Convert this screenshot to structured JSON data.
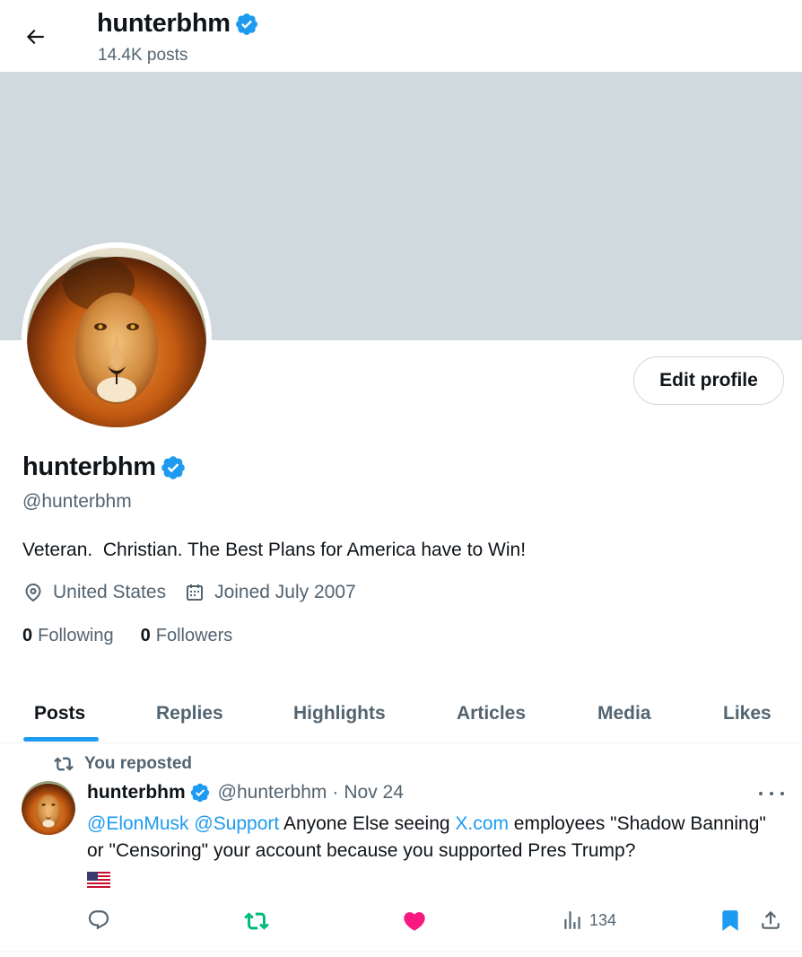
{
  "header": {
    "name": "hunterbhm",
    "posts_count": "14.4K posts"
  },
  "profile": {
    "name": "hunterbhm",
    "handle": "@hunterbhm",
    "bio": "Veteran.  Christian. The Best Plans for America have to Win!",
    "location": "United States",
    "joined": "Joined July 2007",
    "following_count": "0",
    "following_label": "Following",
    "followers_count": "0",
    "followers_label": "Followers",
    "edit_label": "Edit profile"
  },
  "tabs": [
    {
      "label": "Posts",
      "active": true
    },
    {
      "label": "Replies"
    },
    {
      "label": "Highlights"
    },
    {
      "label": "Articles"
    },
    {
      "label": "Media"
    },
    {
      "label": "Likes"
    }
  ],
  "post": {
    "repost_label": "You reposted",
    "author_name": "hunterbhm",
    "author_handle": "@hunterbhm",
    "separator": "·",
    "date": "Nov 24",
    "mention1": "@ElonMusk",
    "mention2": "@Support",
    "text_part1": "Anyone Else seeing",
    "link": "X.com",
    "text_part2": "employees \"Shadow Banning\" or \"Censoring\" your account because you supported Pres Trump?",
    "views": "134"
  },
  "colors": {
    "accent": "#1d9bf0",
    "repost_green": "#00ba7c",
    "like_pink": "#f91880",
    "banner": "#cfd9de",
    "muted": "#536471"
  },
  "icons": {
    "back": "arrow-left-icon",
    "verified": "verified-badge-icon",
    "location": "location-pin-icon",
    "calendar": "calendar-icon",
    "repost": "repost-icon",
    "reply": "reply-icon",
    "like": "heart-icon",
    "views": "views-chart-icon",
    "bookmark": "bookmark-icon",
    "share": "share-icon",
    "more": "more-dots-icon"
  }
}
